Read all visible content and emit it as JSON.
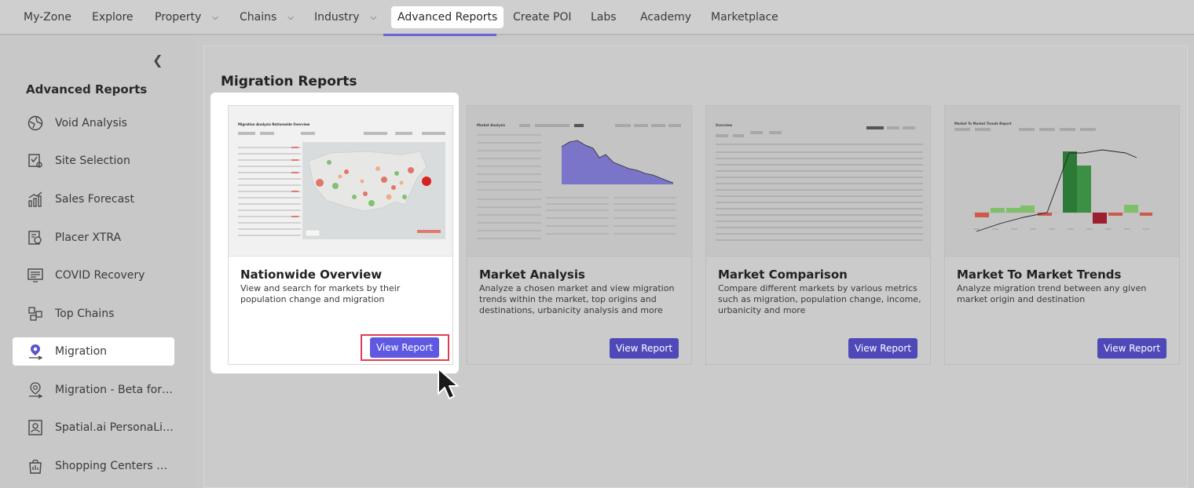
{
  "nav": {
    "items": [
      {
        "label": "My-Zone",
        "dropdown": false
      },
      {
        "label": "Explore",
        "dropdown": false
      },
      {
        "label": "Property",
        "dropdown": true
      },
      {
        "label": "Chains",
        "dropdown": true
      },
      {
        "label": "Industry",
        "dropdown": true
      },
      {
        "label": "Advanced Reports",
        "dropdown": false,
        "active": true
      },
      {
        "label": "Create POI",
        "dropdown": false
      },
      {
        "label": "Labs",
        "dropdown": false
      },
      {
        "label": "Academy",
        "dropdown": false
      },
      {
        "label": "Marketplace",
        "dropdown": false
      }
    ]
  },
  "sidebar": {
    "title": "Advanced Reports",
    "items": [
      {
        "label": "Void Analysis",
        "icon": "void-analysis-icon"
      },
      {
        "label": "Site Selection",
        "icon": "site-selection-icon"
      },
      {
        "label": "Sales Forecast",
        "icon": "sales-forecast-icon"
      },
      {
        "label": "Placer XTRA",
        "icon": "placer-xtra-icon"
      },
      {
        "label": "COVID Recovery",
        "icon": "covid-recovery-icon"
      },
      {
        "label": "Top Chains",
        "icon": "top-chains-icon"
      },
      {
        "label": "Migration",
        "icon": "migration-icon",
        "active": true
      },
      {
        "label": "Migration - Beta for Tes...",
        "icon": "migration-beta-icon"
      },
      {
        "label": "Spatial.ai PersonaLive",
        "icon": "persona-live-icon"
      },
      {
        "label": "Shopping Centers Benc...",
        "icon": "shopping-centers-icon"
      }
    ]
  },
  "main": {
    "title": "Migration Reports",
    "cards": [
      {
        "title": "Nationwide Overview",
        "description": "View and search for markets  by their population change and migration",
        "button": "View Report",
        "thumb_title": "Migration Analysis Nationwide Overview"
      },
      {
        "title": "Market Analysis",
        "description": "Analyze a chosen market and view migration trends within the market, top origins and destinations, urbanicity analysis and more",
        "button": "View Report",
        "thumb_title": "Market Analysis"
      },
      {
        "title": "Market Comparison",
        "description": "Compare different markets by various metrics such as migration, population change, income, urbanicity and more",
        "button": "View Report",
        "thumb_title": "Overview"
      },
      {
        "title": "Market To Market Trends",
        "description": "Analyze migration trend between any given market origin and destination",
        "button": "View Report",
        "thumb_title": "Market To Market Trends Report"
      }
    ]
  },
  "colors": {
    "accent": "#6a64d6",
    "button": "#5f58e0",
    "highlight_outline": "#e23b57"
  }
}
